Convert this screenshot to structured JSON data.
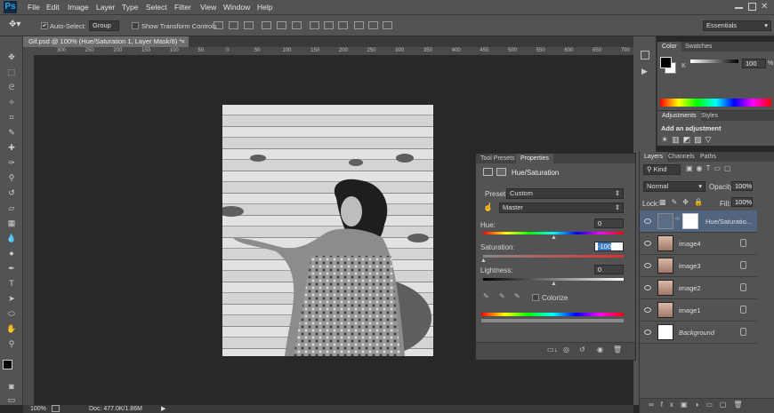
{
  "app": {
    "logo": "Ps"
  },
  "menu": [
    "File",
    "Edit",
    "Image",
    "Layer",
    "Type",
    "Select",
    "Filter",
    "View",
    "Window",
    "Help"
  ],
  "options": {
    "auto_select_label": "Auto-Select:",
    "auto_select_value": "Group",
    "transform_label": "Show Transform Controls",
    "workspace": "Essentials"
  },
  "document": {
    "tab_title": "Gif.psd @ 100% (Hue/Saturation 1, Layer Mask/8) *",
    "ruler_ticks": [
      "300",
      "250",
      "200",
      "150",
      "100",
      "50",
      "0",
      "50",
      "100",
      "150",
      "200",
      "250",
      "300",
      "350",
      "400",
      "450",
      "500",
      "550",
      "600",
      "650",
      "700"
    ],
    "zoom": "100%",
    "doc_size": "Doc: 477.0K/1.86M"
  },
  "color_panel": {
    "tabs": [
      "Color",
      "Swatches"
    ],
    "channel": "K",
    "value": "100",
    "unit": "%"
  },
  "adjustments": {
    "tabs": [
      "Adjustments",
      "Styles"
    ],
    "heading": "Add an adjustment"
  },
  "properties": {
    "tabs": [
      "Tool Presets",
      "Properties"
    ],
    "title": "Hue/Saturation",
    "preset_label": "Preset:",
    "preset_value": "Custom",
    "channel_value": "Master",
    "hue_label": "Hue:",
    "hue_value": "0",
    "saturation_label": "Saturation:",
    "saturation_value": "-100",
    "lightness_label": "Lightness:",
    "lightness_value": "0",
    "colorize_label": "Colorize",
    "hue_level": 0.5,
    "saturation_level": 0.0,
    "lightness_level": 0.5
  },
  "layers": {
    "tabs": [
      "Layers",
      "Channels",
      "Paths"
    ],
    "filter": "Kind",
    "blend_mode": "Normal",
    "opacity_label": "Opacity:",
    "opacity_value": "100%",
    "lock_label": "Lock:",
    "fill_label": "Fill:",
    "fill_value": "100%",
    "items": [
      {
        "name": "Hue/Saturatio...",
        "type": "adjustment"
      },
      {
        "name": "image4",
        "type": "image"
      },
      {
        "name": "image3",
        "type": "image"
      },
      {
        "name": "image2",
        "type": "image"
      },
      {
        "name": "image1",
        "type": "image"
      },
      {
        "name": "Background",
        "type": "background"
      }
    ]
  },
  "colors": {
    "accent": "#3d7cc9",
    "panel": "#535353",
    "canvas": "#282828"
  }
}
